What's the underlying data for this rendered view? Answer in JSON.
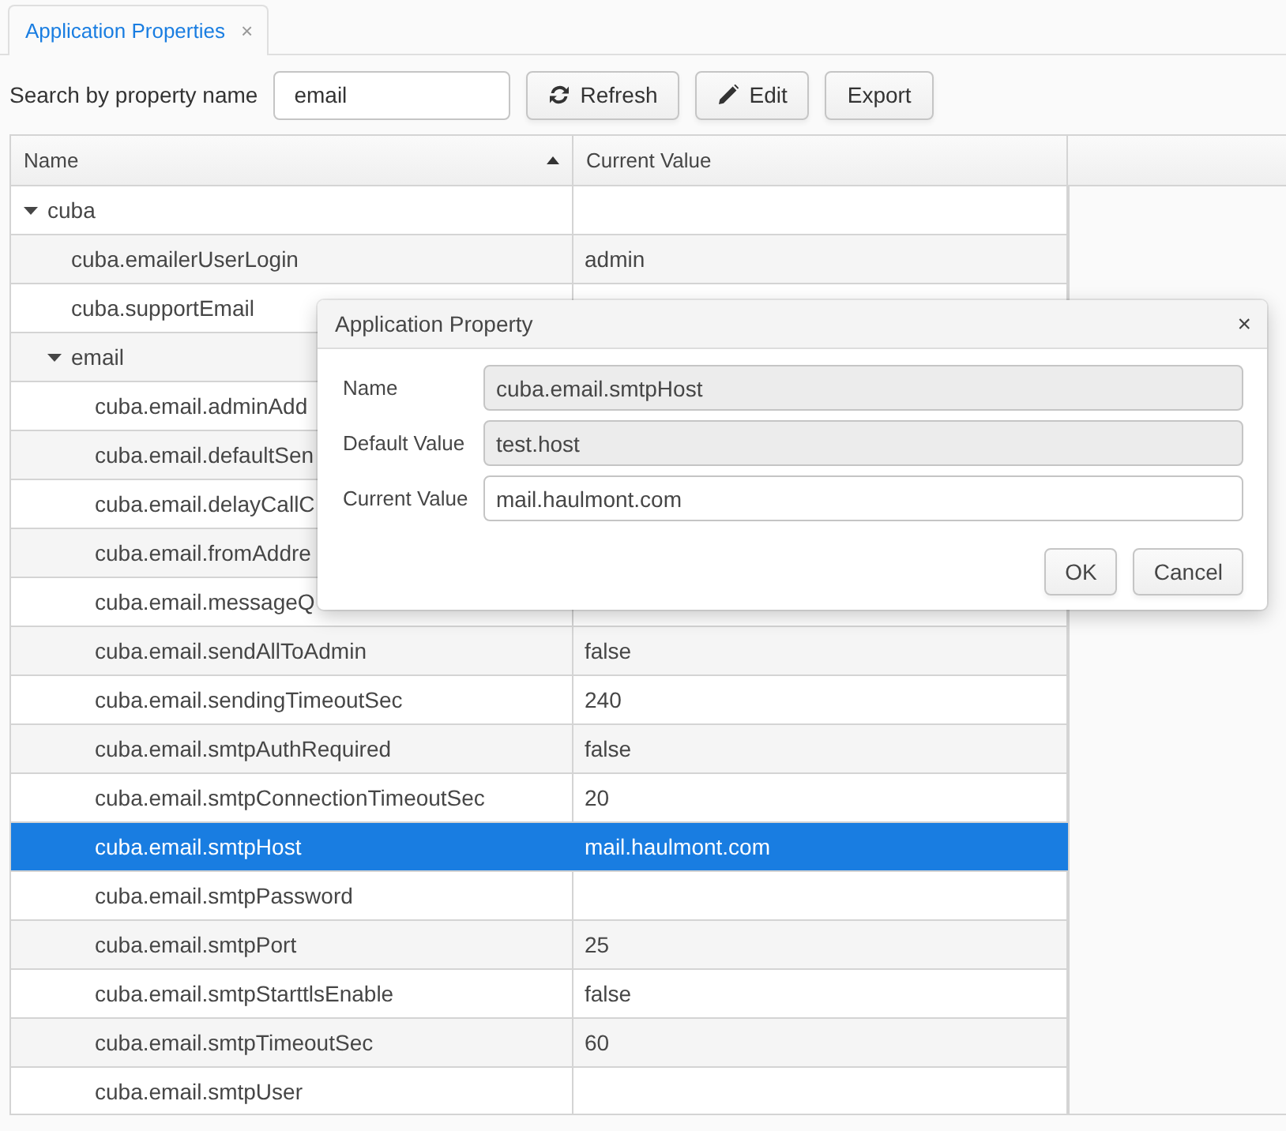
{
  "tabs": [
    {
      "label": "Application Properties",
      "selected": true,
      "close": "×"
    }
  ],
  "toolbar": {
    "search_label": "Search by property name",
    "search": {
      "value": "email"
    },
    "buttons": [
      {
        "label": "Refresh",
        "kind": "refresh"
      },
      {
        "label": "Edit",
        "kind": "edit"
      },
      {
        "label": "Export",
        "kind": "plain"
      }
    ]
  },
  "table": {
    "columns": [
      {
        "label": "Name",
        "sorted": true
      },
      {
        "label": "Current Value",
        "sorted": false
      }
    ],
    "rows": [
      {
        "name": "cuba",
        "expanded": true,
        "selected": false,
        "children": [
          {
            "name": "cuba.emailerUserLogin",
            "value": "admin",
            "selected": false
          },
          {
            "name": "cuba.supportEmail",
            "selected": false
          },
          {
            "name": "email",
            "expanded": true,
            "selected": false,
            "children": [
              {
                "name": "cuba.email.adminAdd",
                "selected": false
              },
              {
                "name": "cuba.email.defaultSen",
                "selected": false
              },
              {
                "name": "cuba.email.delayCallC",
                "selected": false
              },
              {
                "name": "cuba.email.fromAddre",
                "selected": false
              },
              {
                "name": "cuba.email.messageQ",
                "selected": false
              },
              {
                "name": "cuba.email.sendAllToAdmin",
                "value": "false",
                "selected": false
              },
              {
                "name": "cuba.email.sendingTimeoutSec",
                "value": "240",
                "selected": false
              },
              {
                "name": "cuba.email.smtpAuthRequired",
                "value": "false",
                "selected": false
              },
              {
                "name": "cuba.email.smtpConnectionTimeoutSec",
                "value": "20",
                "selected": false
              },
              {
                "name": "cuba.email.smtpHost",
                "value": "mail.haulmont.com",
                "selected": true
              },
              {
                "name": "cuba.email.smtpPassword",
                "selected": false
              },
              {
                "name": "cuba.email.smtpPort",
                "value": "25",
                "selected": false
              },
              {
                "name": "cuba.email.smtpStarttlsEnable",
                "value": "false",
                "selected": false
              },
              {
                "name": "cuba.email.smtpTimeoutSec",
                "value": "60",
                "selected": false
              },
              {
                "name": "cuba.email.smtpUser",
                "selected": false
              }
            ]
          }
        ]
      }
    ]
  },
  "dialog": {
    "title": "Application Property",
    "close": "×",
    "fields": [
      {
        "label": "Name",
        "value": "cuba.email.smtpHost",
        "editable": false
      },
      {
        "label": "Default Value",
        "value": "test.host",
        "editable": false
      },
      {
        "label": "Current Value",
        "value": "mail.haulmont.com",
        "editable": true
      }
    ],
    "buttons": [
      {
        "label": "OK"
      },
      {
        "label": "Cancel"
      }
    ]
  }
}
